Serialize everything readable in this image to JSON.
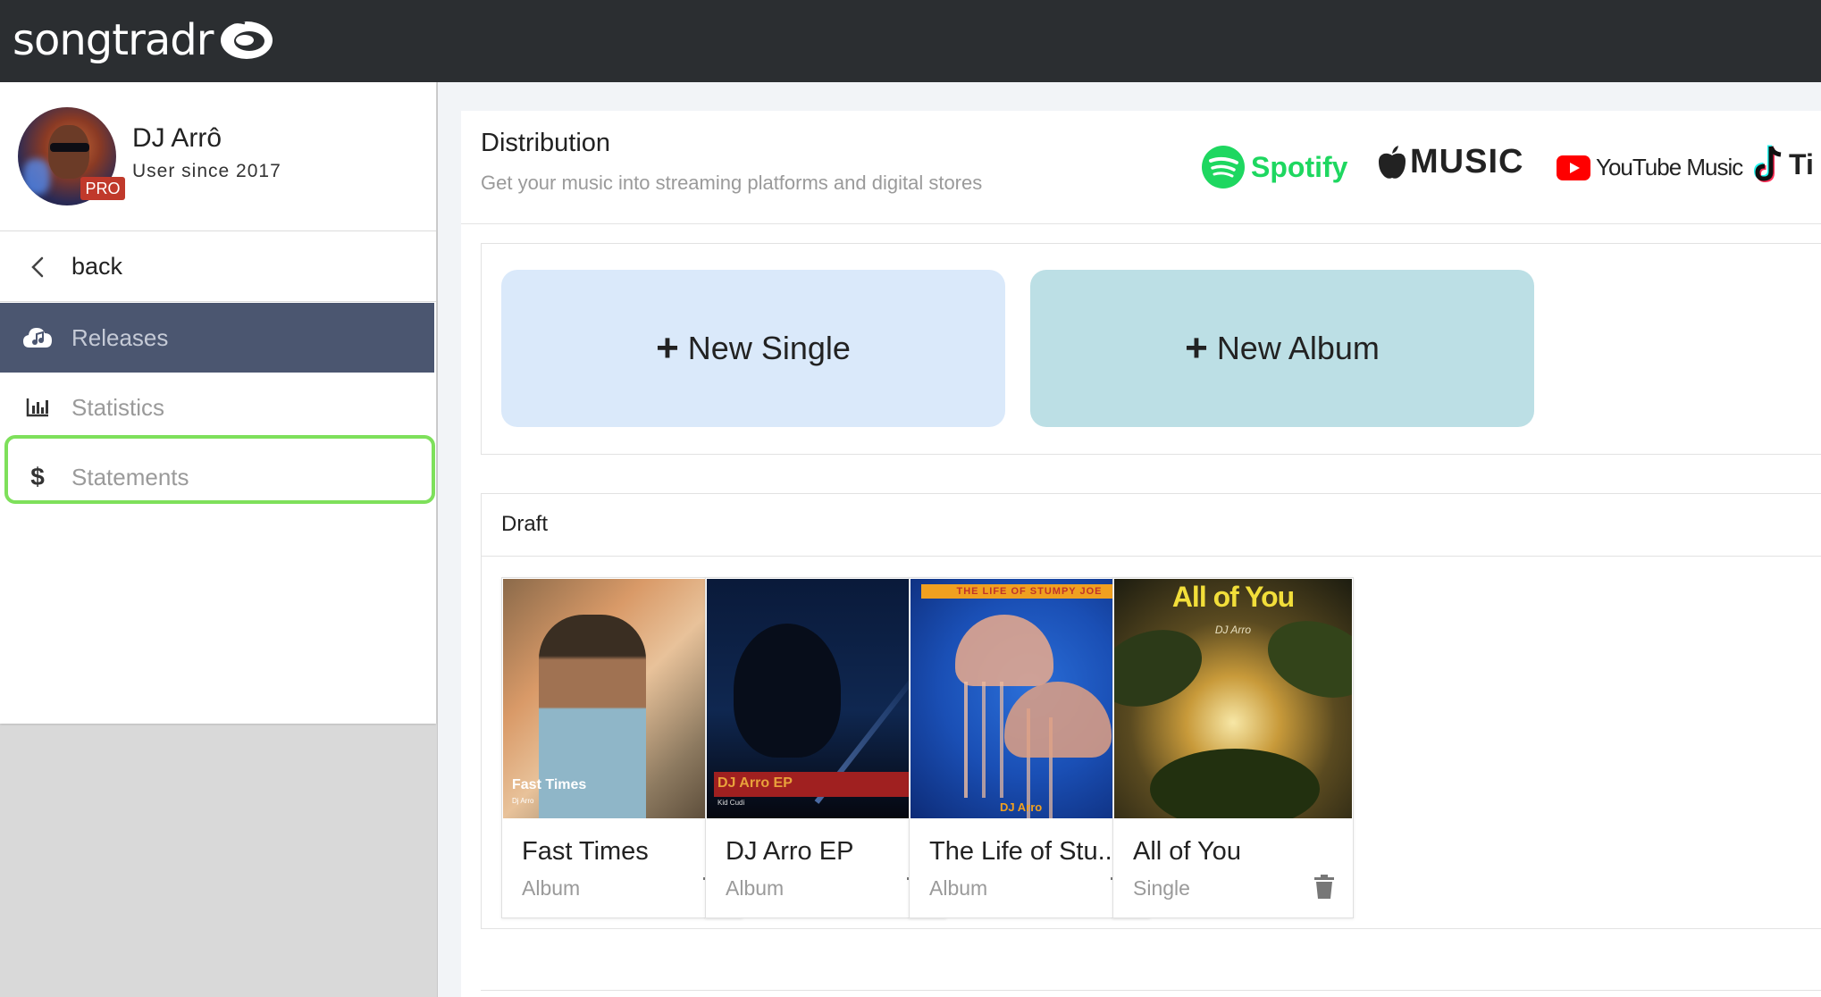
{
  "app": {
    "brand": "songtradr",
    "colors": {
      "topbar": "#2b2e31",
      "active_nav": "#4b5670",
      "highlight": "#7ee05b",
      "spotify": "#1ed760",
      "pro_badge": "#c0392b"
    }
  },
  "profile": {
    "name": "DJ Arrô",
    "since": "User since 2017",
    "badge": "PRO"
  },
  "sidebar": {
    "back_label": "back",
    "items": [
      {
        "label": "Releases",
        "icon": "cloud-music-icon",
        "active": true
      },
      {
        "label": "Statistics",
        "icon": "bar-chart-icon",
        "active": false
      },
      {
        "label": "Statements",
        "icon": "dollar-icon",
        "active": false,
        "highlighted": true
      }
    ]
  },
  "distribution": {
    "title": "Distribution",
    "subtitle": "Get your music into streaming platforms and digital stores",
    "platforms": [
      {
        "name": "Spotify",
        "icon": "spotify-icon"
      },
      {
        "name": "MUSIC",
        "icon": "apple-icon"
      },
      {
        "name": "YouTube Music",
        "icon": "youtube-icon"
      },
      {
        "name": "Ti",
        "icon": "tiktok-icon"
      }
    ]
  },
  "create": {
    "new_single": "New Single",
    "new_album": "New Album"
  },
  "draft": {
    "title": "Draft",
    "cards": [
      {
        "title": "Fast Times",
        "type": "Album",
        "art_title": "Fast Times",
        "art_sub": "Dj Arro"
      },
      {
        "title": "DJ Arro EP",
        "type": "Album",
        "art_title": "DJ Arro EP",
        "art_sub": "Kid Cudi"
      },
      {
        "title": "The Life of Stu...",
        "type": "Album",
        "art_top": "THE LIFE OF STUMPY JOE",
        "art_title": "DJ Arro"
      },
      {
        "title": "All of You",
        "type": "Single",
        "art_title": "All of You",
        "art_sub": "DJ Arro"
      }
    ]
  }
}
